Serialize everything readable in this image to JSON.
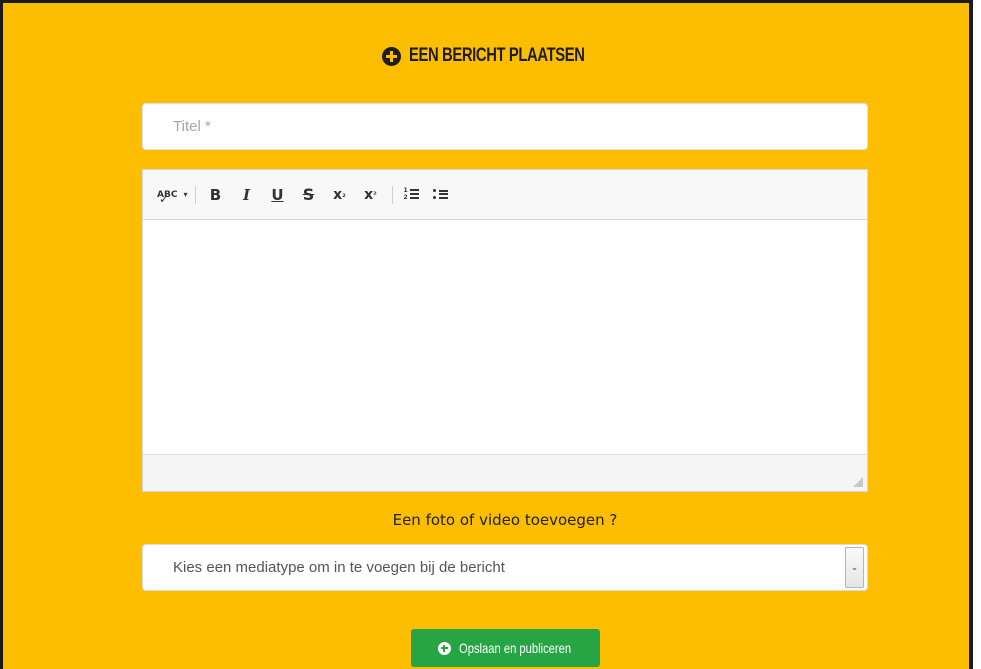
{
  "header": {
    "title": "EEN BERICHT PLAATSEN",
    "icon": "plus-circle-icon"
  },
  "form": {
    "title_placeholder": "Titel *",
    "title_value": "",
    "editor": {
      "toolbar": {
        "spellcheck_label": "ABC",
        "bold_label": "B",
        "italic_label": "I",
        "underline_label": "U",
        "strike_label": "S",
        "subscript_label": "x",
        "superscript_label": "x"
      },
      "content": ""
    },
    "media_label": "Een foto of video toevoegen ?",
    "media_select": {
      "selected": "Kies een mediatype om in te voegen bij de bericht"
    },
    "publish_label": "Opslaan en publiceren"
  },
  "colors": {
    "background": "#fdbe02",
    "button": "#27a443",
    "text_dark": "#1e1e1e"
  }
}
